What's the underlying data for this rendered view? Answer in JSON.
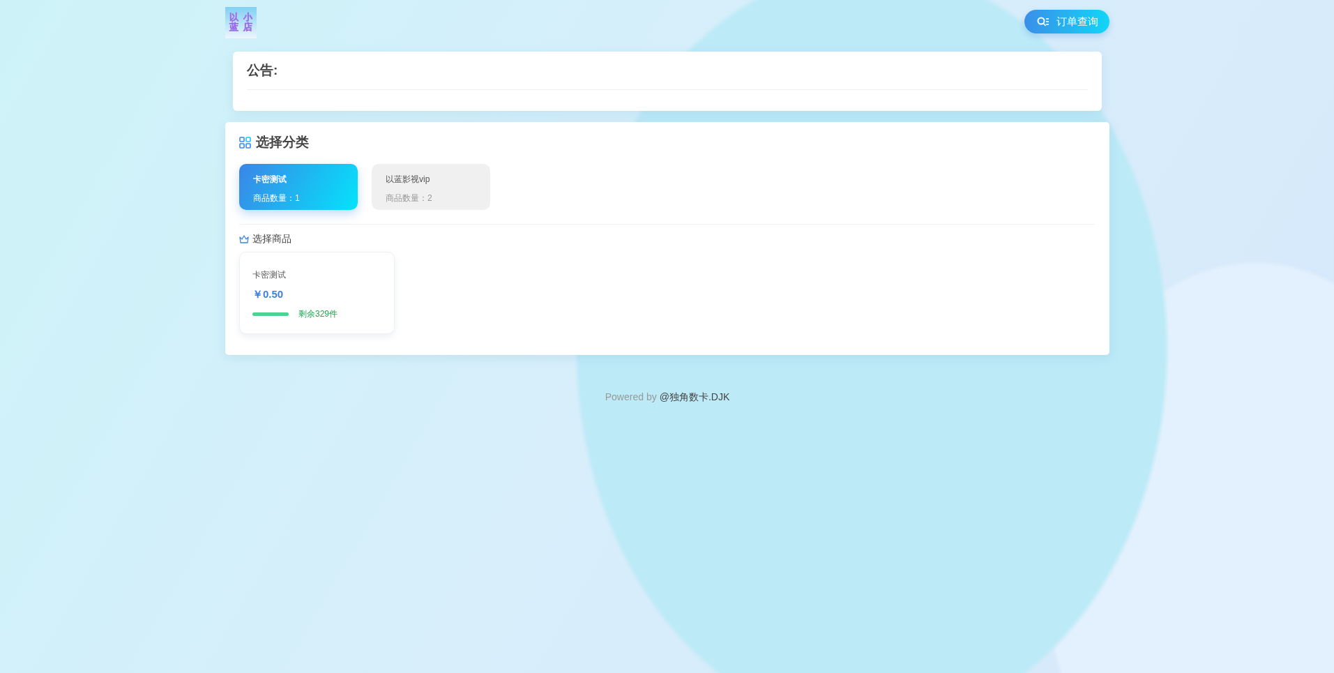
{
  "header": {
    "logo": {
      "lines": [
        "以蓝",
        "小店"
      ]
    },
    "order_button": {
      "label": "订单查询"
    }
  },
  "notice": {
    "title": "公告:"
  },
  "categories": {
    "title": "选择分类",
    "items": [
      {
        "name": "卡密测试",
        "count": "商品数量：1",
        "selected": true
      },
      {
        "name": "以蓝影视vip",
        "count": "商品数量：2",
        "selected": false
      }
    ]
  },
  "products": {
    "title": "选择商品",
    "items": [
      {
        "name": "卡密测试",
        "price": "￥0.50",
        "stock": "剩余329件",
        "level": 1
      }
    ]
  },
  "footer": {
    "prefix": "Powered by",
    "link": "@独角数卡.DJK"
  }
}
